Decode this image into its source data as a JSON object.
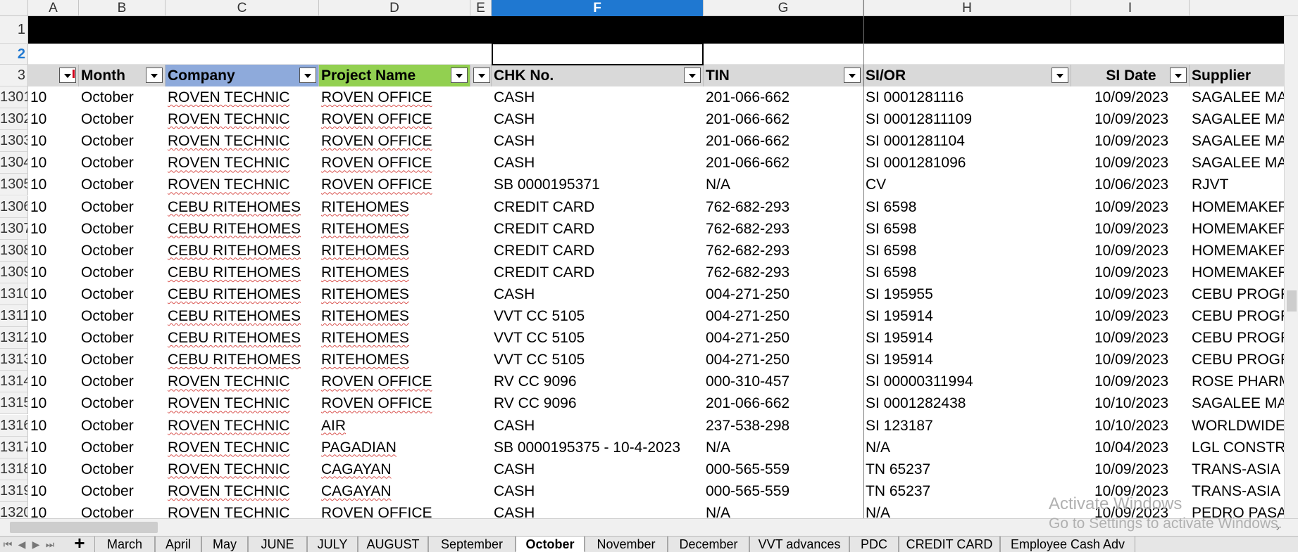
{
  "column_letters": [
    "A",
    "B",
    "C",
    "D",
    "E",
    "F",
    "G",
    "H",
    "I"
  ],
  "active_column": "F",
  "header_row": {
    "row_numbers": [
      "1",
      "2",
      "3"
    ],
    "month": "Month",
    "company": "Company",
    "project": "Project Name",
    "chk": "CHK No.",
    "tin": "TIN",
    "sior": "SI/OR",
    "sidate": "SI Date",
    "supplier": "Supplier"
  },
  "rows": [
    {
      "num": "1301",
      "a": "10",
      "month": "October",
      "company": "ROVEN TECHNIC",
      "project": "ROVEN OFFICE",
      "chk": "CASH",
      "tin": "201-066-662",
      "sior": "SI 0001281116",
      "sidate": "10/09/2023",
      "supplier": "SAGALEE MAN"
    },
    {
      "num": "1302",
      "a": "10",
      "month": "October",
      "company": "ROVEN TECHNIC",
      "project": "ROVEN OFFICE",
      "chk": "CASH",
      "tin": "201-066-662",
      "sior": "SI 00012811109",
      "sidate": "10/09/2023",
      "supplier": "SAGALEE MAN"
    },
    {
      "num": "1303",
      "a": "10",
      "month": "October",
      "company": "ROVEN TECHNIC",
      "project": "ROVEN OFFICE",
      "chk": "CASH",
      "tin": "201-066-662",
      "sior": "SI 0001281104",
      "sidate": "10/09/2023",
      "supplier": "SAGALEE MAN"
    },
    {
      "num": "1304",
      "a": "10",
      "month": "October",
      "company": "ROVEN TECHNIC",
      "project": "ROVEN OFFICE",
      "chk": "CASH",
      "tin": "201-066-662",
      "sior": "SI 0001281096",
      "sidate": "10/09/2023",
      "supplier": "SAGALEE MAN"
    },
    {
      "num": "1305",
      "a": "10",
      "month": "October",
      "company": "ROVEN TECHNIC",
      "project": "ROVEN OFFICE",
      "chk": "SB 0000195371",
      "tin": "N/A",
      "sior": "CV",
      "sidate": "10/06/2023",
      "supplier": "RJVT"
    },
    {
      "num": "1306",
      "a": "10",
      "month": "October",
      "company": "CEBU RITEHOMES",
      "project": "RITEHOMES",
      "chk": "CREDIT CARD",
      "tin": "762-682-293",
      "sior": "SI 6598",
      "sidate": "10/09/2023",
      "supplier": "HOMEMAKER"
    },
    {
      "num": "1307",
      "a": "10",
      "month": "October",
      "company": "CEBU RITEHOMES",
      "project": "RITEHOMES",
      "chk": "CREDIT CARD",
      "tin": "762-682-293",
      "sior": "SI 6598",
      "sidate": "10/09/2023",
      "supplier": "HOMEMAKER"
    },
    {
      "num": "1308",
      "a": "10",
      "month": "October",
      "company": "CEBU RITEHOMES",
      "project": "RITEHOMES",
      "chk": "CREDIT CARD",
      "tin": "762-682-293",
      "sior": "SI 6598",
      "sidate": "10/09/2023",
      "supplier": "HOMEMAKER"
    },
    {
      "num": "1309",
      "a": "10",
      "month": "October",
      "company": "CEBU RITEHOMES",
      "project": "RITEHOMES",
      "chk": "CREDIT CARD",
      "tin": "762-682-293",
      "sior": "SI 6598",
      "sidate": "10/09/2023",
      "supplier": "HOMEMAKER"
    },
    {
      "num": "1310",
      "a": "10",
      "month": "October",
      "company": "CEBU RITEHOMES",
      "project": "RITEHOMES",
      "chk": "CASH",
      "tin": "004-271-250",
      "sior": "SI 195955",
      "sidate": "10/09/2023",
      "supplier": "CEBU PROGRE"
    },
    {
      "num": "1311",
      "a": "10",
      "month": "October",
      "company": "CEBU RITEHOMES",
      "project": "RITEHOMES",
      "chk": "VVT CC 5105",
      "tin": "004-271-250",
      "sior": "SI 195914",
      "sidate": "10/09/2023",
      "supplier": "CEBU PROGRE"
    },
    {
      "num": "1312",
      "a": "10",
      "month": "October",
      "company": "CEBU RITEHOMES",
      "project": "RITEHOMES",
      "chk": "VVT CC 5105",
      "tin": "004-271-250",
      "sior": "SI 195914",
      "sidate": "10/09/2023",
      "supplier": "CEBU PROGRE"
    },
    {
      "num": "1313",
      "a": "10",
      "month": "October",
      "company": "CEBU RITEHOMES",
      "project": "RITEHOMES",
      "chk": "VVT CC 5105",
      "tin": "004-271-250",
      "sior": "SI 195914",
      "sidate": "10/09/2023",
      "supplier": "CEBU PROGRE"
    },
    {
      "num": "1314",
      "a": "10",
      "month": "October",
      "company": "ROVEN TECHNIC",
      "project": "ROVEN OFFICE",
      "chk": "RV CC 9096",
      "tin": "000-310-457",
      "sior": "SI 00000311994",
      "sidate": "10/09/2023",
      "supplier": "ROSE PHARMA"
    },
    {
      "num": "1315",
      "a": "10",
      "month": "October",
      "company": "ROVEN TECHNIC",
      "project": "ROVEN OFFICE",
      "chk": "RV CC 9096",
      "tin": "201-066-662",
      "sior": "SI 0001282438",
      "sidate": "10/10/2023",
      "supplier": "SAGALEE MAN"
    },
    {
      "num": "1316",
      "a": "10",
      "month": "October",
      "company": "ROVEN TECHNIC",
      "project": "AIR",
      "chk": "CASH",
      "tin": "237-538-298",
      "sior": "SI 123187",
      "sidate": "10/10/2023",
      "supplier": "WORLDWIDE I"
    },
    {
      "num": "1317",
      "a": "10",
      "month": "October",
      "company": "ROVEN TECHNIC",
      "project": "PAGADIAN",
      "chk": "SB 0000195375 - 10-4-2023",
      "tin": "N/A",
      "sior": "N/A",
      "sidate": "10/04/2023",
      "supplier": "LGL CONSTRUC"
    },
    {
      "num": "1318",
      "a": "10",
      "month": "October",
      "company": "ROVEN TECHNIC",
      "project": "CAGAYAN",
      "chk": "CASH",
      "tin": "000-565-559",
      "sior": "TN 65237",
      "sidate": "10/09/2023",
      "supplier": "TRANS-ASIA SH"
    },
    {
      "num": "1319",
      "a": "10",
      "month": "October",
      "company": "ROVEN TECHNIC",
      "project": "CAGAYAN",
      "chk": "CASH",
      "tin": "000-565-559",
      "sior": "TN 65237",
      "sidate": "10/09/2023",
      "supplier": "TRANS-ASIA SH"
    },
    {
      "num": "1320",
      "a": "10",
      "month": "October",
      "company": "ROVEN TECHNIC",
      "project": "ROVEN OFFICE",
      "chk": "CASH",
      "tin": "N/A",
      "sior": "N/A",
      "sidate": "10/09/2023",
      "supplier": "PEDRO PASAS"
    }
  ],
  "sheet_tabs": [
    "March",
    "April",
    "May",
    "JUNE",
    "JULY",
    "AUGUST",
    "September",
    "October",
    "November",
    "December",
    "VVT advances",
    "PDC",
    "CREDIT CARD",
    "Employee Cash Adv"
  ],
  "active_tab": "October",
  "add_sheet": "+",
  "watermark": {
    "line1": "Activate Windows",
    "line2": "Go to Settings to activate Windows."
  }
}
